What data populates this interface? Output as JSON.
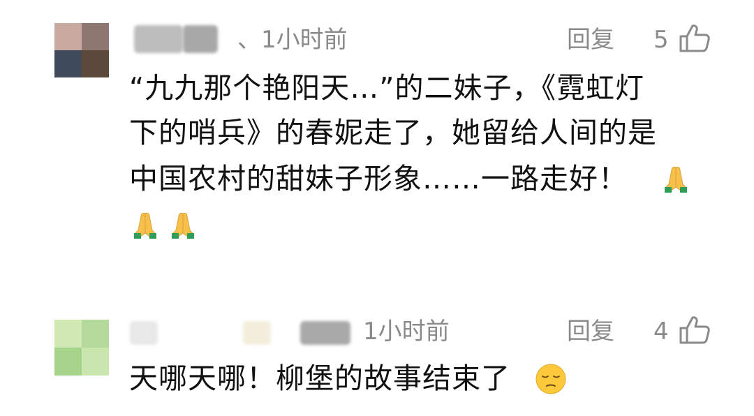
{
  "comments": [
    {
      "time": "、1小时前",
      "reply_label": "回复",
      "like_count": "5",
      "text_lines": [
        "“九九那个艳阳天…”的二妹子，《霓虹灯",
        "下的哨兵》的春妮走了，她留给人间的是",
        "中国农村的甜妹子形象……一路走好！"
      ],
      "emoji_icons": [
        "folded-hands-icon",
        "folded-hands-icon",
        "folded-hands-icon"
      ]
    },
    {
      "time": "1小时前",
      "reply_label": "回复",
      "like_count": "4",
      "text_lines": [
        "天哪天哪！柳堡的故事结束了"
      ],
      "emoji_icons": [
        "pensive-face-icon"
      ]
    }
  ],
  "colors": {
    "meta_gray": "#8a8a8a",
    "text": "#111111",
    "divider": "#e6e6e6"
  }
}
